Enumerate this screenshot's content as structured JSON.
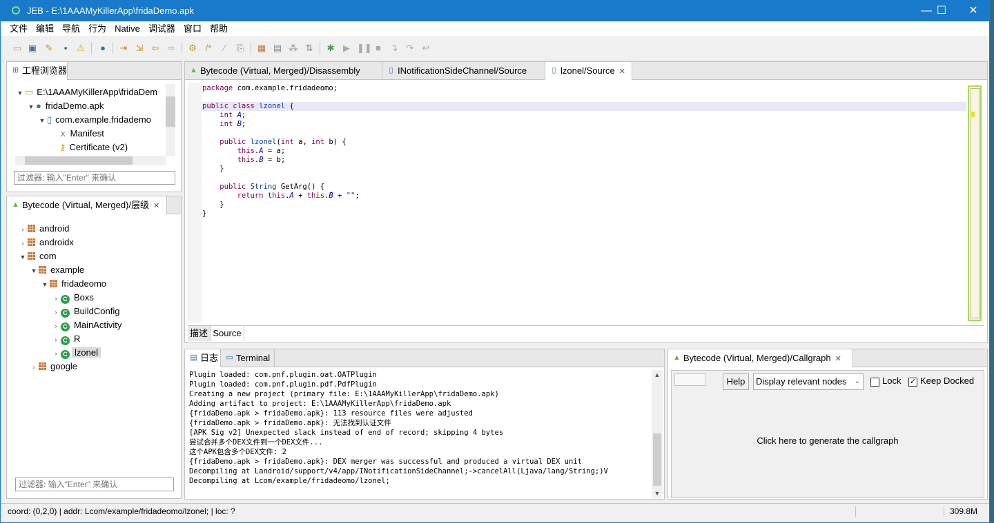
{
  "window": {
    "title": "JEB - E:\\1AAAMyKillerApp\\fridaDemo.apk",
    "minimize": "—",
    "maximize": "☐",
    "close": "✕"
  },
  "menu": [
    "文件",
    "编辑",
    "导航",
    "行为",
    "Native",
    "调试器",
    "窗口",
    "帮助"
  ],
  "project_explorer": {
    "tab": "工程浏览器",
    "items": [
      {
        "label": "E:\\1AAAMyKillerApp\\fridaDem"
      },
      {
        "label": "fridaDemo.apk"
      },
      {
        "label": "com.example.fridademo"
      },
      {
        "label": "Manifest"
      },
      {
        "label": "Certificate (v2)"
      }
    ],
    "filter_placeholder": "过滤器: 输入\"Enter\" 来确认"
  },
  "hierarchy": {
    "tab": "Bytecode (Virtual, Merged)/层级",
    "items": [
      {
        "label": "android"
      },
      {
        "label": "androidx"
      },
      {
        "label": "com"
      },
      {
        "label": "example"
      },
      {
        "label": "fridadeomo"
      },
      {
        "label": "Boxs",
        "class_icon": "C"
      },
      {
        "label": "BuildConfig",
        "class_icon": "C"
      },
      {
        "label": "MainActivity",
        "class_icon": "C"
      },
      {
        "label": "R",
        "class_icon": "C"
      },
      {
        "label": "lzonel",
        "class_icon": "C"
      },
      {
        "label": "google"
      }
    ],
    "filter_placeholder": "过滤器: 输入\"Enter\" 来确认"
  },
  "editor": {
    "tabs": [
      "Bytecode (Virtual, Merged)/Disassembly",
      "INotificationSideChannel/Source",
      "lzonel/Source"
    ],
    "code": {
      "l1_kw": "package",
      "l1_rest": " com.example.fridadeomo;",
      "l3_kw1": "public",
      "l3_kw2": "class",
      "l3_name": "lzonel",
      "l3_brace": " {",
      "l4_kw": "int",
      "l4_f": "A",
      "l5_kw": "int",
      "l5_f": "B",
      "l7_kw": "public",
      "l7_name": "lzonel",
      "l7_kw2": "int",
      "l7_a": " a, ",
      "l7_kw3": "int",
      "l7_b": " b) {",
      "l8_kw": "this",
      "l8_f": "A",
      "l8_rest": " = a;",
      "l9_kw": "this",
      "l9_f": "B",
      "l9_rest": " = b;",
      "l10": "}",
      "l12_kw": "public",
      "l12_type": "String",
      "l12_rest": " GetArg() {",
      "l13_kw": "return",
      "l13_kw2": "this",
      "l13_fa": "A",
      "l13_kw3": "this",
      "l13_fb": "B",
      "l13_str": "\"\"",
      "l14": "}",
      "l15": "}"
    },
    "bottom_tabs": [
      "描述",
      "Source"
    ]
  },
  "console": {
    "tabs": [
      "日志",
      "Terminal"
    ],
    "lines": [
      "Plugin loaded: com.pnf.plugin.oat.OATPlugin",
      "Plugin loaded: com.pnf.plugin.pdf.PdfPlugin",
      "Creating a new project (primary file: E:\\1AAAMyKillerApp\\fridaDemo.apk)",
      "Adding artifact to project: E:\\1AAAMyKillerApp\\fridaDemo.apk",
      "{fridaDemo.apk > fridaDemo.apk}: 113 resource files were adjusted",
      "{fridaDemo.apk > fridaDemo.apk}: 无法找到认证文件",
      "[APK Sig v2] Unexpected slack instead of end of record; skipping 4 bytes",
      "尝试合并多个DEX文件到一个DEX文件...",
      "这个APK包含多个DEX文件: 2",
      "{fridaDemo.apk > fridaDemo.apk}: DEX merger was successful and produced a virtual DEX unit",
      "Decompiling at Landroid/support/v4/app/INotificationSideChannel;->cancelAll(Ljava/lang/String;)V",
      "Decompiling at Lcom/example/fridadeomo/lzonel;"
    ]
  },
  "callgraph": {
    "tab": "Bytecode (Virtual, Merged)/Callgraph",
    "help": "Help",
    "select_value": "Display relevant nodes",
    "lock": "Lock",
    "keep_docked": "Keep Docked",
    "lock_checked": false,
    "keep_docked_checked": true,
    "message": "Click here to generate the callgraph"
  },
  "status": {
    "text": "coord: (0,2,0) | addr: Lcom/example/fridadeomo/lzonel; | loc: ?",
    "memory": "309.8M"
  }
}
